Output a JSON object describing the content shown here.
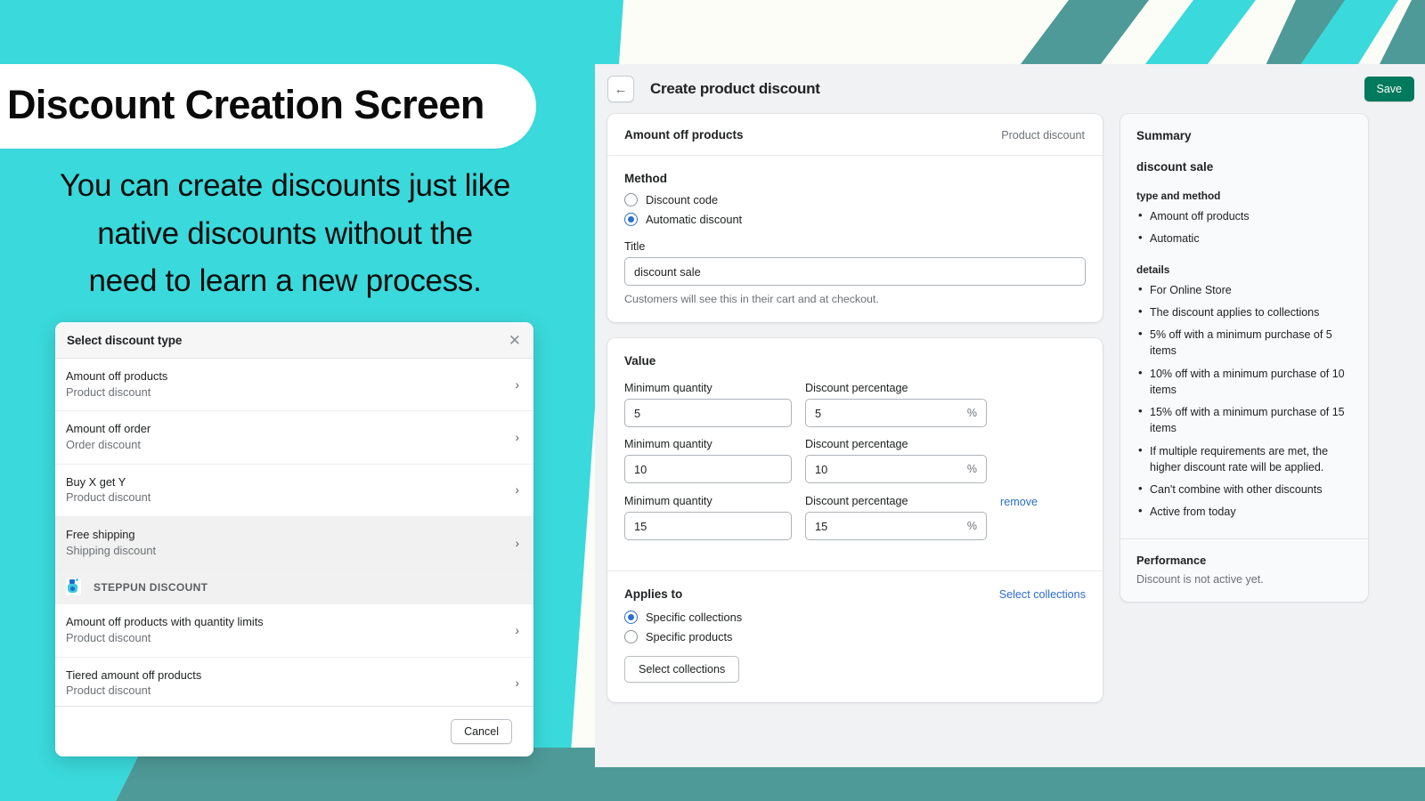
{
  "marketing": {
    "headline": "Discount Creation Screen",
    "body_line1": "You can create discounts just like",
    "body_line2": "native discounts without the",
    "body_line3": "need to learn a new process."
  },
  "colors": {
    "teal": "#3AD9DB",
    "teal_dark": "#4E9A98",
    "cream": "#FDFDF7",
    "save_green": "#00795C",
    "link_blue": "#2C6ECB",
    "radio_blue": "#2C6ECB"
  },
  "modal": {
    "title": "Select discount type",
    "close_icon": "close-icon",
    "chevron_icon": "chevron-right-icon",
    "items": [
      {
        "name": "Amount off products",
        "sub": "Product discount",
        "shaded": false
      },
      {
        "name": "Amount off order",
        "sub": "Order discount",
        "shaded": false
      },
      {
        "name": "Buy X get Y",
        "sub": "Product discount",
        "shaded": false
      },
      {
        "name": "Free shipping",
        "sub": "Shipping discount",
        "shaded": true
      }
    ],
    "app_group": {
      "icon": "steppun-app-icon",
      "label": "STEPPUN DISCOUNT"
    },
    "app_items": [
      {
        "name": "Amount off products with quantity limits",
        "sub": "Product discount",
        "shaded": false
      },
      {
        "name": "Tiered amount off products",
        "sub": "Product discount",
        "shaded": false
      }
    ],
    "cancel_label": "Cancel"
  },
  "admin": {
    "topbar": {
      "back_icon": "arrow-left-icon",
      "title": "Create product discount",
      "save_label": "Save"
    },
    "type_card": {
      "title": "Amount off products",
      "badge": "Product discount",
      "method_label": "Method",
      "methods": [
        {
          "label": "Discount code",
          "selected": false
        },
        {
          "label": "Automatic discount",
          "selected": true
        }
      ],
      "title_label": "Title",
      "title_value": "discount sale",
      "title_help": "Customers will see this in their cart and at checkout."
    },
    "value_card": {
      "title": "Value",
      "qty_label": "Minimum quantity",
      "pct_label": "Discount percentage",
      "percent_suffix": "%",
      "remove_label": "remove",
      "tiers": [
        {
          "qty": "5",
          "pct": "5",
          "removable": false
        },
        {
          "qty": "10",
          "pct": "10",
          "removable": false
        },
        {
          "qty": "15",
          "pct": "15",
          "removable": true
        }
      ]
    },
    "applies_card": {
      "title": "Applies to",
      "link_label": "Select collections",
      "options": [
        {
          "label": "Specific collections",
          "selected": true
        },
        {
          "label": "Specific products",
          "selected": false
        }
      ],
      "button_label": "Select collections"
    },
    "summary": {
      "heading": "Summary",
      "discount_name": "discount sale",
      "type_method_label": "type and method",
      "type_method": [
        "Amount off products",
        "Automatic"
      ],
      "details_label": "details",
      "details": [
        "For Online Store",
        "The discount applies to collections",
        "5% off with a minimum purchase of 5 items",
        "10% off with a minimum purchase of 10 items",
        "15% off with a minimum purchase of 15 items",
        "If multiple requirements are met, the higher discount rate will be applied.",
        "Can't combine with other discounts",
        "Active from today"
      ],
      "performance_heading": "Performance",
      "performance_text": "Discount is not active yet."
    }
  }
}
